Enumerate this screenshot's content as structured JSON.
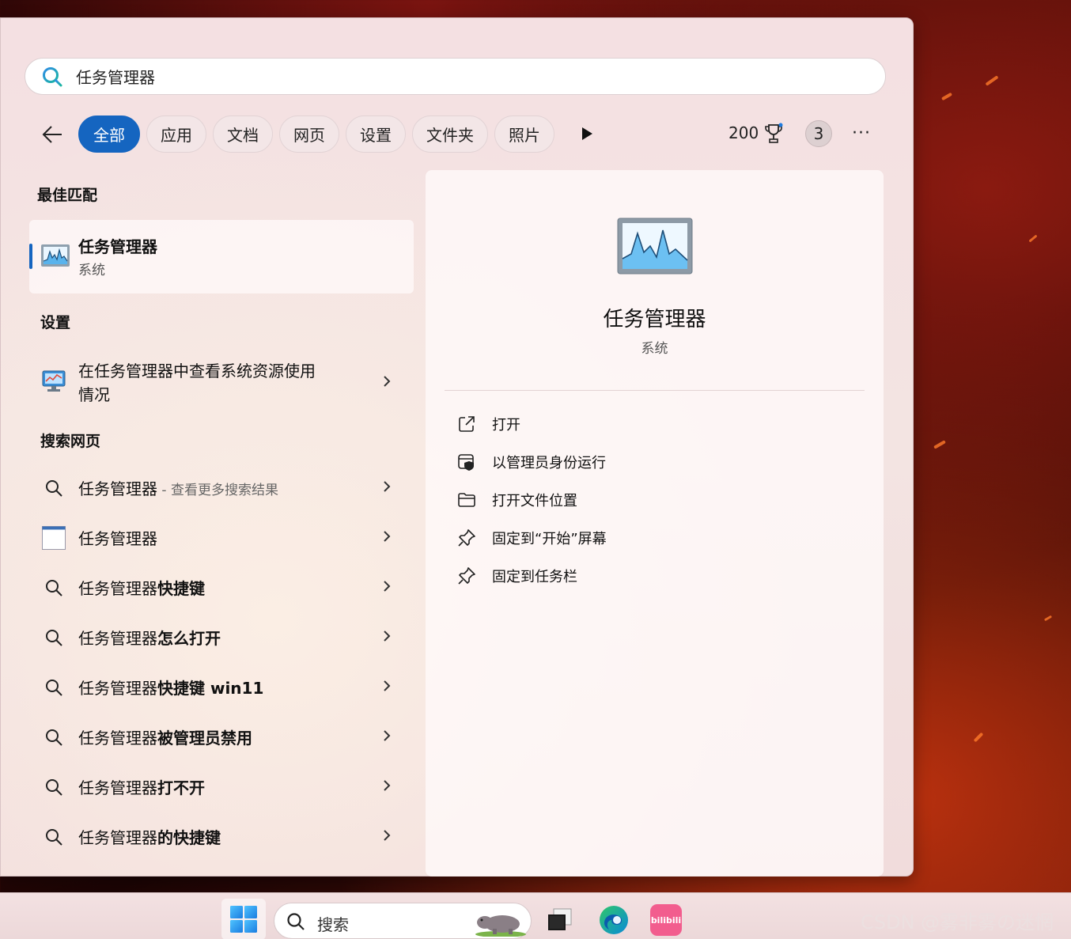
{
  "search": {
    "value": "任务管理器",
    "icon": "search-icon"
  },
  "filters": {
    "back_icon": "back-arrow-icon",
    "chips": [
      "全部",
      "应用",
      "文档",
      "网页",
      "设置",
      "文件夹",
      "照片"
    ],
    "active": "全部",
    "more_play_icon": "play-icon",
    "points": "200",
    "trophy_icon": "trophy-icon",
    "badge_count": "3",
    "more_label": "···"
  },
  "sections": {
    "best_match": "最佳匹配",
    "settings": "设置",
    "web": "搜索网页"
  },
  "best_match": {
    "title": "任务管理器",
    "subtitle": "系统",
    "icon": "task-manager-icon"
  },
  "settings_items": [
    {
      "line1": "在任务管理器中查看系统资源使用",
      "line2": "情况",
      "icon": "monitor-icon"
    }
  ],
  "web_items": [
    {
      "prefix": "任务管理器",
      "suffix": " - 查看更多搜索结果",
      "icon": "search-icon"
    },
    {
      "prefix": "任务管理器",
      "suffix": "",
      "icon": "window-thumbnail-icon"
    },
    {
      "prefix": "任务管理器",
      "suffix": "快捷键",
      "icon": "search-icon"
    },
    {
      "prefix": "任务管理器",
      "suffix": "怎么打开",
      "icon": "search-icon"
    },
    {
      "prefix": "任务管理器",
      "suffix": "快捷键 win11",
      "icon": "search-icon"
    },
    {
      "prefix": "任务管理器",
      "suffix": "被管理员禁用",
      "icon": "search-icon"
    },
    {
      "prefix": "任务管理器",
      "suffix": "打不开",
      "icon": "search-icon"
    },
    {
      "prefix": "任务管理器",
      "suffix": "的快捷键",
      "icon": "search-icon"
    }
  ],
  "detail": {
    "title": "任务管理器",
    "subtitle": "系统",
    "actions": [
      {
        "label": "打开",
        "icon": "open-external-icon"
      },
      {
        "label": "以管理员身份运行",
        "icon": "shield-icon"
      },
      {
        "label": "打开文件位置",
        "icon": "folder-icon"
      },
      {
        "label": "固定到“开始”屏幕",
        "icon": "pin-icon"
      },
      {
        "label": "固定到任务栏",
        "icon": "pin-icon"
      }
    ]
  },
  "taskbar": {
    "search_placeholder": "搜索",
    "apps": [
      "windows-start-icon",
      "task-view-icon",
      "edge-icon",
      "bilibili-icon"
    ],
    "bilibili_logo": "bilibili"
  },
  "watermark": "CSDN @雾非雾の迷惘",
  "colors": {
    "accent": "#1565c0",
    "panel": "#f4e0e2",
    "wallpaper": "#4a0c08"
  }
}
